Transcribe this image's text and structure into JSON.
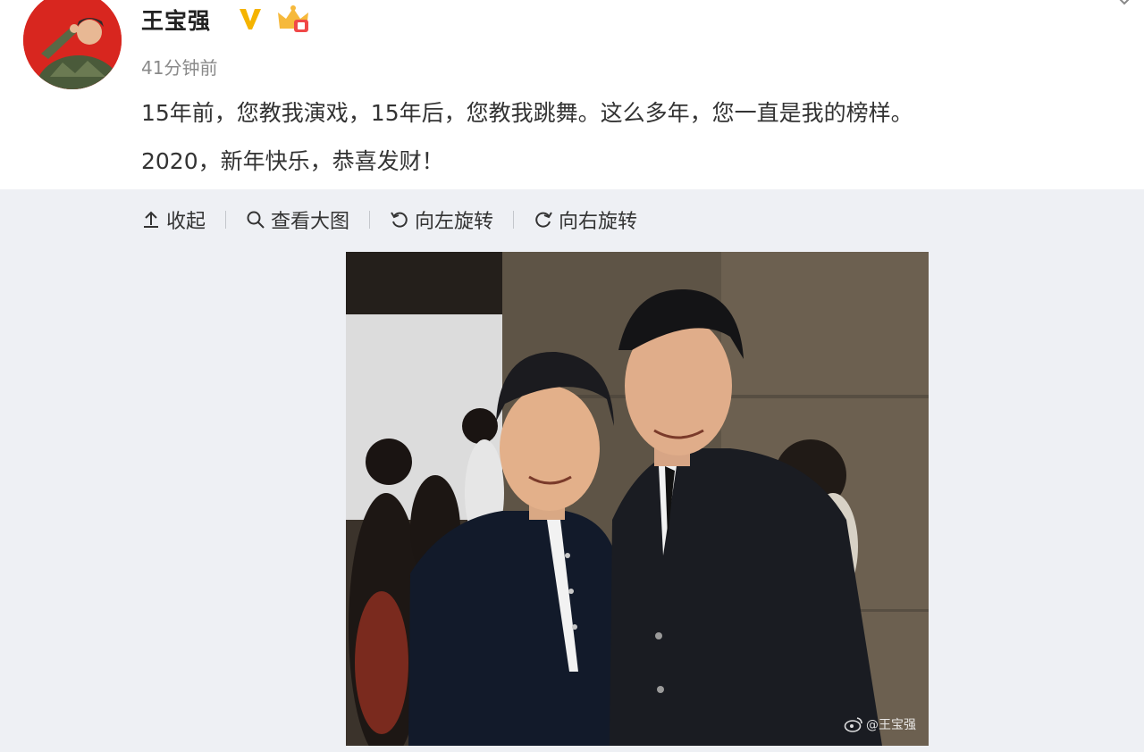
{
  "user": {
    "name": "王宝强",
    "time": "41分钟前"
  },
  "post": {
    "lines": [
      "15年前，您教我演戏，15年后，您教我跳舞。这么多年，您一直是我的榜样。",
      "2020，新年快乐，恭喜发财！"
    ]
  },
  "toolbar": {
    "collapse": "收起",
    "view_large": "查看大图",
    "rotate_left": "向左旋转",
    "rotate_right": "向右旋转"
  },
  "image": {
    "watermark": "@王宝强"
  },
  "icons": {
    "verified": "verified-v-icon",
    "vip": "vip-crown-icon",
    "collapse": "arrow-up-icon",
    "view": "search-icon",
    "rotate_left": "rotate-left-icon",
    "rotate_right": "rotate-right-icon",
    "weibo": "weibo-logo-icon"
  },
  "colors": {
    "verified": "#f5b400",
    "avatar_bg": "#d8261f",
    "page_bg": "#eef0f4"
  }
}
